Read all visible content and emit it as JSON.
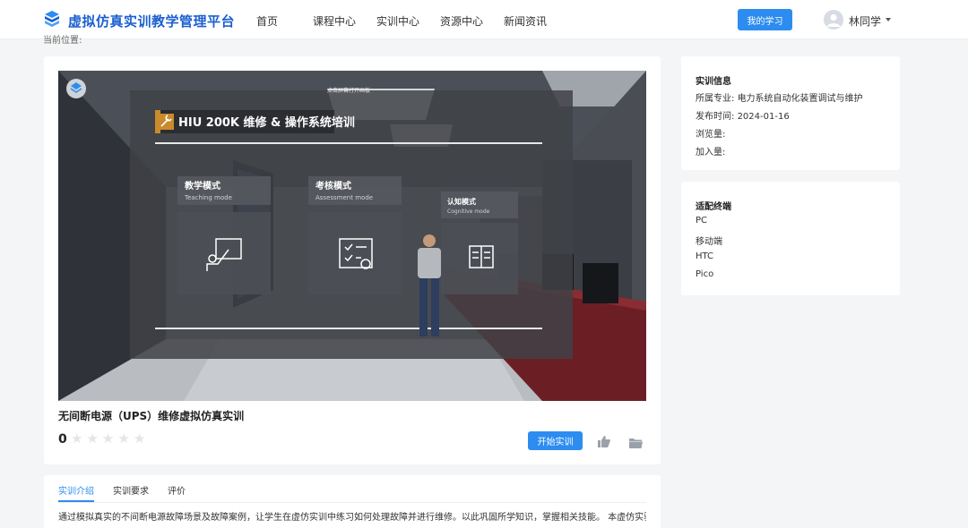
{
  "header": {
    "title": "虚拟仿真实训教学管理平台",
    "nav": [
      "首页",
      "课程中心",
      "实训中心",
      "资源中心",
      "新闻资讯"
    ],
    "my_learning": "我的学习",
    "username": "林同学"
  },
  "breadcrumb": "当前位置:",
  "course": {
    "title": "无间断电源（UPS）维修虚拟仿真实训",
    "score": "0",
    "rating_stars": 0,
    "start_button": "开始实训"
  },
  "scene": {
    "hint": "点击屏幕打开画板",
    "banner": "HIU 200K 维修 & 操作系统培训",
    "modes": [
      {
        "title": "教学模式",
        "subtitle": "Teaching mode"
      },
      {
        "title": "考核模式",
        "subtitle": "Assessment mode"
      },
      {
        "title": "认知模式",
        "subtitle": "Cognitive mode"
      }
    ]
  },
  "tabs": [
    "实训介绍",
    "实训要求",
    "评价"
  ],
  "description": "通过模拟真实的不间断电源故障场景及故障案例，让学生在虚仿实训中练习如何处理故障并进行维修。以此巩固所学知识，掌握相关技能。 本虚仿实验",
  "info": {
    "title": "实训信息",
    "major_label": "所属专业:",
    "major": "电力系统自动化装置调试与维护",
    "date_label": "发布时间:",
    "date": "2024-01-16",
    "views_label": "浏览量:",
    "joins_label": "加入量:"
  },
  "terminals": {
    "title": "适配终端",
    "items": [
      "PC",
      "移动端",
      "HTC",
      "Pico"
    ]
  },
  "colors": {
    "primary": "#2d8cf0",
    "brand": "#1b5fd0"
  },
  "icons": [
    "logo-cube-icon",
    "user-avatar-icon",
    "caret-down-icon",
    "star-icon",
    "thumbs-up-icon",
    "folder-icon",
    "wrench-icon",
    "teaching-board-icon",
    "assessment-checklist-icon",
    "book-icon"
  ]
}
